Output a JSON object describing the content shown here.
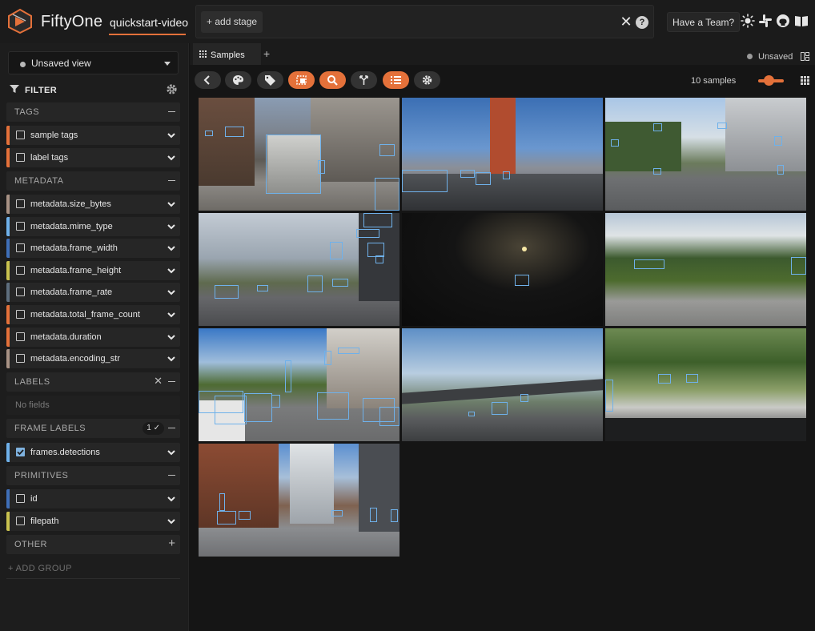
{
  "header": {
    "brand": "FiftyOne",
    "dataset_name": "quickstart-video",
    "add_stage": "+ add stage",
    "team_button": "Have a Team?",
    "icons": [
      "sun-icon",
      "slack-icon",
      "github-icon",
      "book-icon"
    ]
  },
  "sidebar": {
    "view_select": "Unsaved view",
    "filter_title": "FILTER",
    "groups": {
      "tags": "TAGS",
      "metadata": "METADATA",
      "labels": "LABELS",
      "labels_empty": "No fields",
      "frame_labels": "FRAME LABELS",
      "frame_labels_badge": "1 ✓",
      "primitives": "PRIMITIVES",
      "other": "OTHER"
    },
    "fields": {
      "sample_tags": "sample tags",
      "label_tags": "label tags",
      "size_bytes": "metadata.size_bytes",
      "mime_type": "metadata.mime_type",
      "frame_width": "metadata.frame_width",
      "frame_height": "metadata.frame_height",
      "frame_rate": "metadata.frame_rate",
      "total_frame_count": "metadata.total_frame_count",
      "duration": "metadata.duration",
      "encoding_str": "metadata.encoding_str",
      "frames_detections": "frames.detections",
      "id": "id",
      "filepath": "filepath"
    },
    "add_group": "+ ADD GROUP",
    "field_colors": {
      "sample_tags": "#e4713a",
      "label_tags": "#e4713a",
      "size_bytes": "#a89285",
      "mime_type": "#6fb1ea",
      "frame_width": "#3f6fb8",
      "frame_height": "#c9c24f",
      "frame_rate": "#5e6e7d",
      "total_frame_count": "#e4713a",
      "duration": "#e4713a",
      "encoding_str": "#a89285",
      "frames_detections": "#6fb1ea",
      "id": "#3f6fb8",
      "filepath": "#c9c24f"
    }
  },
  "main": {
    "tab_label": "Samples",
    "unsaved_label": "Unsaved",
    "sample_count": "10 samples",
    "slider_value": 0.5,
    "accent": "#e4713a"
  }
}
